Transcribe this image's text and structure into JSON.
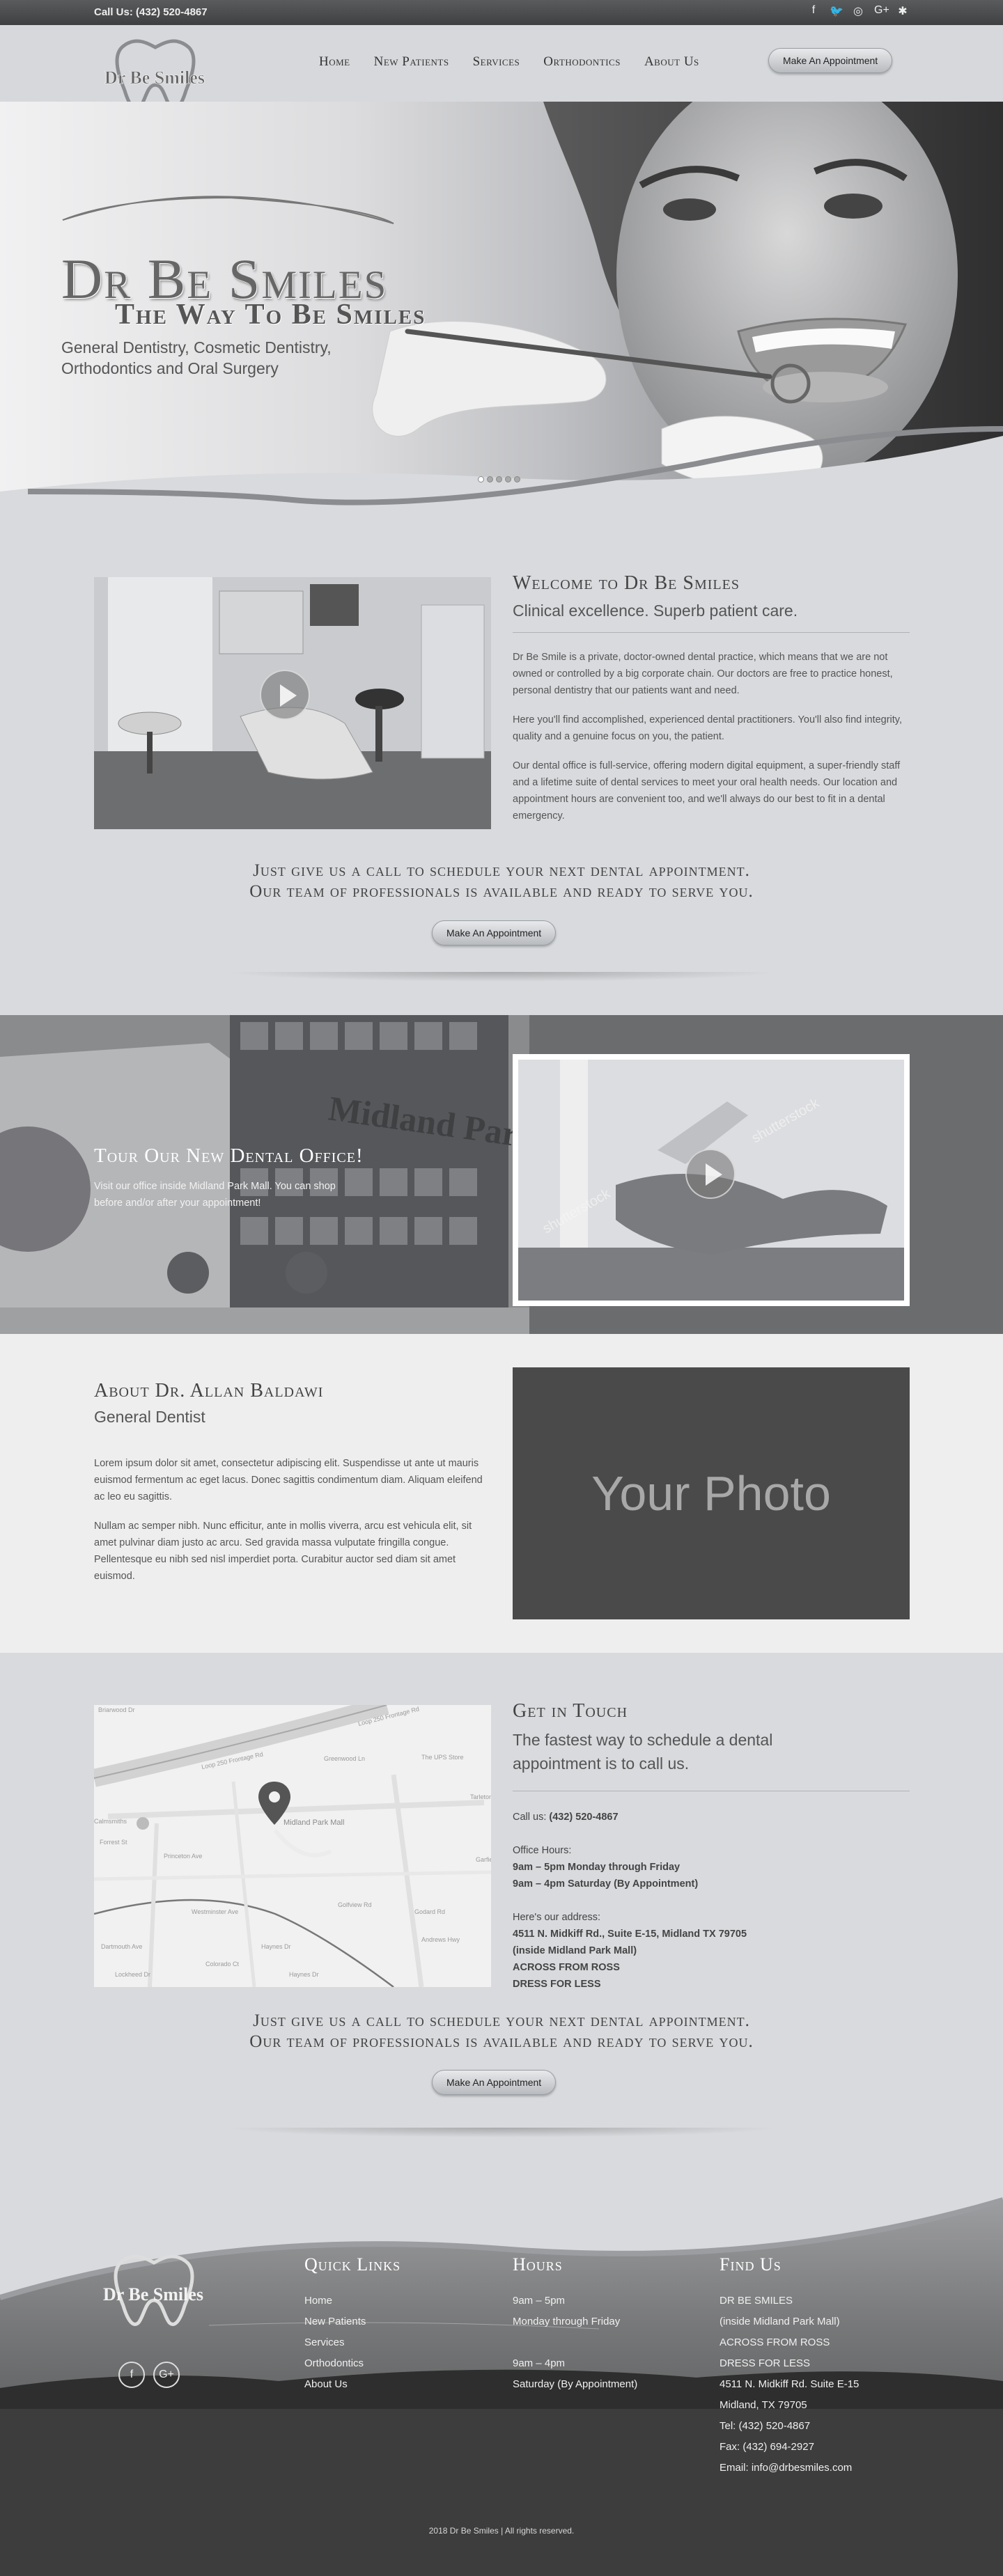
{
  "topbar": {
    "call_label": "Call Us: (432) 520-4867",
    "social_icons": [
      "facebook-icon",
      "twitter-icon",
      "instagram-icon",
      "google-plus-icon",
      "yelp-icon"
    ]
  },
  "logo": {
    "text": "Dr Be Smiles"
  },
  "nav": {
    "items": [
      "Home",
      "New Patients",
      "Services",
      "Orthodontics",
      "About Us"
    ],
    "cta": "Make An Appointment"
  },
  "hero": {
    "title": "Dr Be Smiles",
    "tagline": "The Way To Be Smiles",
    "subtitle": "General Dentistry, Cosmetic Dentistry, Orthodontics and Oral Surgery",
    "slide_count": 5
  },
  "welcome": {
    "heading": "Welcome to Dr Be Smiles",
    "subheading": "Clinical excellence. Superb patient care.",
    "paragraphs": [
      "Dr Be Smile is a private, doctor-owned dental practice, which means that we are not owned or controlled by a big corporate chain. Our doctors are free to practice honest, personal dentistry that our patients want and need.",
      "Here you'll find accomplished, experienced dental practitioners. You'll also find integrity, quality and a genuine focus on you, the patient.",
      "Our dental office is full-service, offering modern digital equipment, a super-friendly staff and a lifetime suite of dental services to meet your oral health needs. Our location and appointment hours are convenient too, and we'll always do our best to fit in a dental emergency."
    ]
  },
  "cta": {
    "line1": "Just give us a call to schedule your next dental appointment.",
    "line2": "Our team of professionals is available and ready to serve you.",
    "button": "Make An Appointment"
  },
  "tour": {
    "heading": "Tour Our New Dental Office!",
    "text": "Visit our office inside Midland Park Mall. You can shop before and/or after your appointment!",
    "building_sign": "Midland Park Mall",
    "watermark": "shutterstock"
  },
  "about": {
    "heading": "About Dr. Allan Baldawi",
    "subheading": "General Dentist",
    "paragraphs": [
      "Lorem ipsum dolor sit amet, consectetur adipiscing elit. Suspendisse ut ante ut mauris euismod fermentum ac eget lacus. Donec sagittis condimentum diam. Aliquam eleifend ac leo eu sagittis.",
      "Nullam ac semper nibh. Nunc efficitur, ante in mollis viverra, arcu est vehicula elit, sit amet pulvinar diam justo ac arcu. Sed gravida massa vulputate fringilla congue. Pellentesque eu nibh sed nisl imperdiet porta. Curabitur auctor sed diam sit amet euismod."
    ],
    "photo_placeholder": "Your Photo"
  },
  "map": {
    "labels": [
      "Loop 250 Frontage Rd",
      "Loop 250 Frontage Rd",
      "The UPS Store",
      "Midland Park Mall",
      "Garfield St",
      "Tarleton St",
      "Golfview Rd",
      "Haynes Dr",
      "Haynes Dr",
      "Andrews Hwy",
      "Dartmouth Ave",
      "Godard Rd",
      "Lockheed Dr",
      "Greenwood Ln",
      "Princeton Ave",
      "Westminster Ave",
      "Forrest St",
      "Colorado Ct",
      "Calmsmiths",
      "Briarwood Dr"
    ]
  },
  "contact": {
    "heading": "Get in Touch",
    "subheading": "The fastest way to schedule a dental appointment is to call us.",
    "call_prefix": "Call us:",
    "phone": "(432) 520-4867",
    "hours_label": "Office Hours:",
    "hours": [
      "9am – 5pm Monday through Friday",
      "9am – 4pm Saturday (By Appointment)"
    ],
    "address_label": "Here's our address:",
    "address": [
      "4511 N. Midkiff Rd., Suite E-15, Midland TX 79705",
      "(inside Midland Park Mall)",
      "ACROSS FROM ROSS",
      "DRESS FOR LESS"
    ]
  },
  "footer": {
    "quick_links_title": "Quick Links",
    "quick_links": [
      "Home",
      "New Patients",
      "Services",
      "Orthodontics",
      "About Us"
    ],
    "hours_title": "Hours",
    "hours": [
      "9am – 5pm",
      "Monday through Friday",
      "",
      "9am – 4pm",
      "Saturday (By Appointment)"
    ],
    "find_title": "Find Us",
    "find": [
      "DR BE SMILES",
      "(inside Midland Park Mall)",
      "ACROSS FROM ROSS",
      "DRESS FOR LESS",
      "4511 N. Midkiff Rd. Suite E-15",
      "Midland, TX 79705",
      "Tel: (432) 520-4867",
      "Fax: (432) 694-2927",
      "Email: info@drbesmiles.com"
    ],
    "social_icons": [
      "facebook-icon",
      "google-plus-icon"
    ],
    "copyright": "2018 Dr Be Smiles | All rights reserved."
  }
}
